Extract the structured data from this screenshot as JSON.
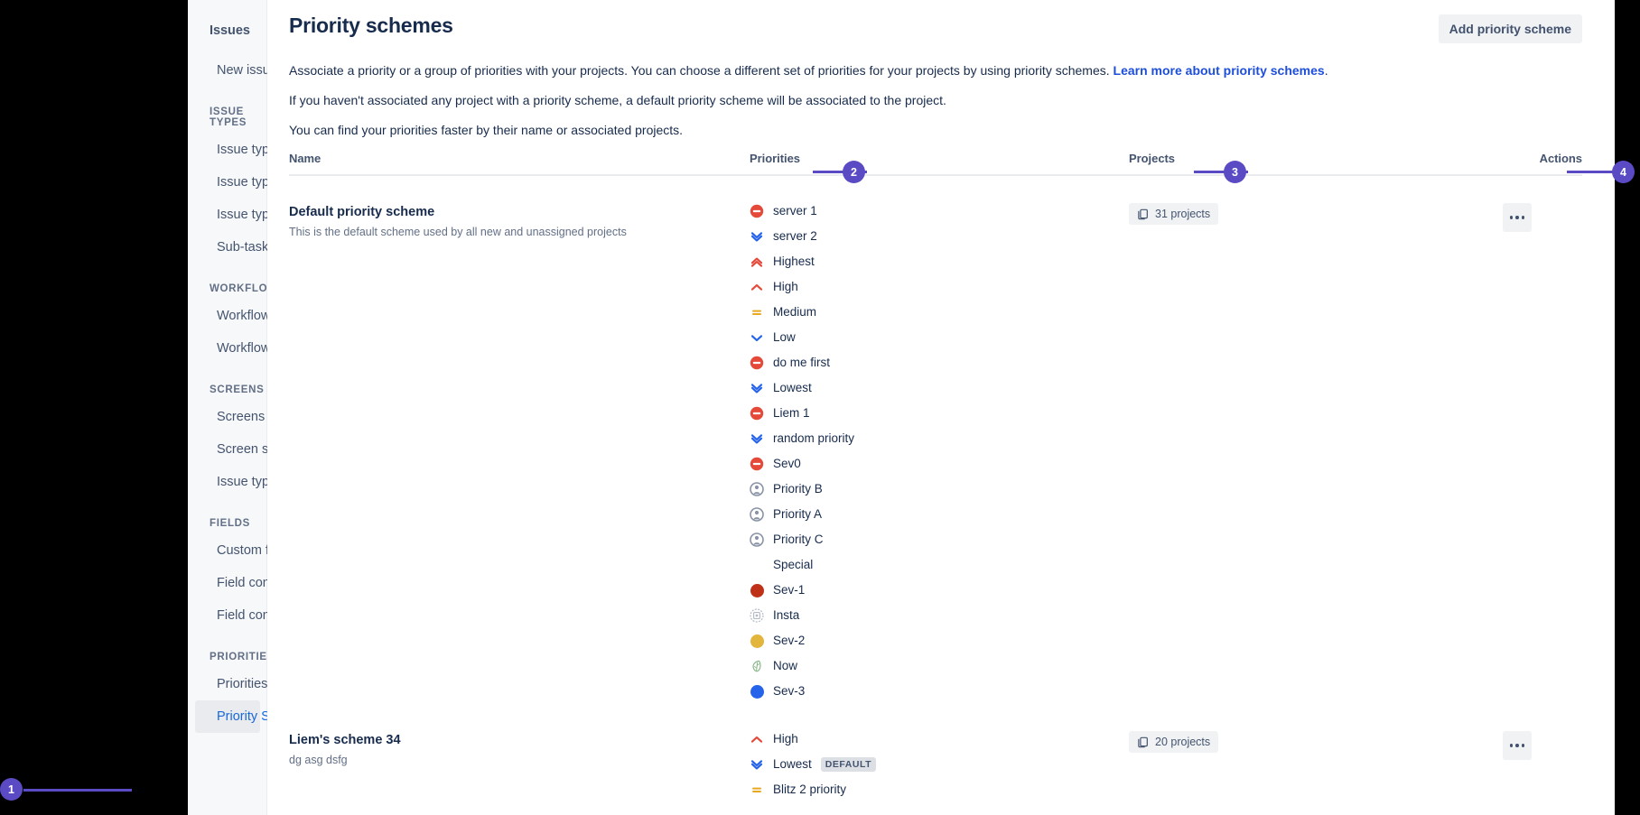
{
  "sidebar": {
    "title": "Issues",
    "items": [
      {
        "type": "link",
        "label": "New issue search transition",
        "selected": false
      },
      {
        "type": "section",
        "label": "ISSUE TYPES"
      },
      {
        "type": "link",
        "label": "Issue type hierarchy",
        "selected": false
      },
      {
        "type": "link",
        "label": "Issue types",
        "selected": false
      },
      {
        "type": "link",
        "label": "Issue type schemes",
        "selected": false
      },
      {
        "type": "link",
        "label": "Sub-tasks",
        "selected": false
      },
      {
        "type": "section",
        "label": "WORKFLOWS"
      },
      {
        "type": "link",
        "label": "Workflows",
        "selected": false
      },
      {
        "type": "link",
        "label": "Workflow schemes",
        "selected": false
      },
      {
        "type": "section",
        "label": "SCREENS"
      },
      {
        "type": "link",
        "label": "Screens",
        "selected": false
      },
      {
        "type": "link",
        "label": "Screen schemes",
        "selected": false
      },
      {
        "type": "link",
        "label": "Issue type screen schemes",
        "selected": false
      },
      {
        "type": "section",
        "label": "FIELDS"
      },
      {
        "type": "link",
        "label": "Custom fields",
        "selected": false
      },
      {
        "type": "link",
        "label": "Field configurations",
        "selected": false
      },
      {
        "type": "link",
        "label": "Field configuration schemes",
        "selected": false
      },
      {
        "type": "section",
        "label": "PRIORITIES"
      },
      {
        "type": "link",
        "label": "Priorities",
        "selected": false
      },
      {
        "type": "link",
        "label": "Priority Schemes",
        "selected": true
      }
    ]
  },
  "header": {
    "title": "Priority schemes",
    "add_button": "Add priority scheme"
  },
  "intro": {
    "line1_before": "Associate a priority or a group of priorities with your projects. You can choose a different set of priorities for your projects by using priority schemes. ",
    "line1_link": "Learn more about priority schemes",
    "line1_after": ".",
    "line2": "If you haven't associated any project with a priority scheme, a default priority scheme will be associated to the project.",
    "line3": "You can find your priorities faster by their name or associated projects."
  },
  "table": {
    "headers": {
      "name": "Name",
      "priorities": "Priorities",
      "projects": "Projects",
      "actions": "Actions"
    },
    "rows": [
      {
        "name": "Default priority scheme",
        "description": "This is the default scheme used by all new and unassigned projects",
        "projects_label": "31 projects",
        "priorities": [
          {
            "label": "server 1",
            "icon": "blocker-icon",
            "color": "#e5493a"
          },
          {
            "label": "server 2",
            "icon": "lowest-icon",
            "color": "#2563eb"
          },
          {
            "label": "Highest",
            "icon": "highest-icon",
            "color": "#e5493a"
          },
          {
            "label": "High",
            "icon": "high-icon",
            "color": "#e5493a"
          },
          {
            "label": "Medium",
            "icon": "medium-icon",
            "color": "#e9a820"
          },
          {
            "label": "Low",
            "icon": "low-icon",
            "color": "#2563eb"
          },
          {
            "label": "do me first",
            "icon": "blocker-icon",
            "color": "#e5493a"
          },
          {
            "label": "Lowest",
            "icon": "lowest-icon",
            "color": "#2563eb"
          },
          {
            "label": "Liem 1",
            "icon": "blocker-icon",
            "color": "#e5493a"
          },
          {
            "label": "random priority",
            "icon": "lowest-icon",
            "color": "#2563eb"
          },
          {
            "label": "Sev0",
            "icon": "blocker-icon",
            "color": "#e5493a"
          },
          {
            "label": "Priority B",
            "icon": "person-icon",
            "color": "#8993a4"
          },
          {
            "label": "Priority A",
            "icon": "person-icon",
            "color": "#8993a4"
          },
          {
            "label": "Priority C",
            "icon": "person-icon",
            "color": "#8993a4"
          },
          {
            "label": "Special",
            "icon": "none-icon",
            "color": "transparent"
          },
          {
            "label": "Sev-1",
            "icon": "dot-icon",
            "color": "#bf3019"
          },
          {
            "label": "Insta",
            "icon": "broken-image-icon",
            "color": "#b3bac5"
          },
          {
            "label": "Sev-2",
            "icon": "dot-icon",
            "color": "#e2b53c"
          },
          {
            "label": "Now",
            "icon": "leaf-icon",
            "color": "#8bb98b"
          },
          {
            "label": "Sev-3",
            "icon": "dot-icon",
            "color": "#2563eb"
          }
        ]
      },
      {
        "name": "Liem's scheme 34",
        "description": "dg asg dsfg",
        "projects_label": "20 projects",
        "priorities": [
          {
            "label": "High",
            "icon": "high-icon",
            "color": "#e5493a"
          },
          {
            "label": "Lowest",
            "icon": "lowest-icon",
            "color": "#2563eb",
            "badge": "DEFAULT"
          },
          {
            "label": "Blitz 2 priority",
            "icon": "medium-icon",
            "color": "#e9a820"
          }
        ]
      }
    ]
  },
  "annotations": [
    {
      "number": "1"
    },
    {
      "number": "2"
    },
    {
      "number": "3"
    },
    {
      "number": "4"
    }
  ],
  "colors": {
    "accent_marker": "#5a4bc4",
    "link": "#1d4ed8",
    "selected_nav_text": "#1868db"
  }
}
